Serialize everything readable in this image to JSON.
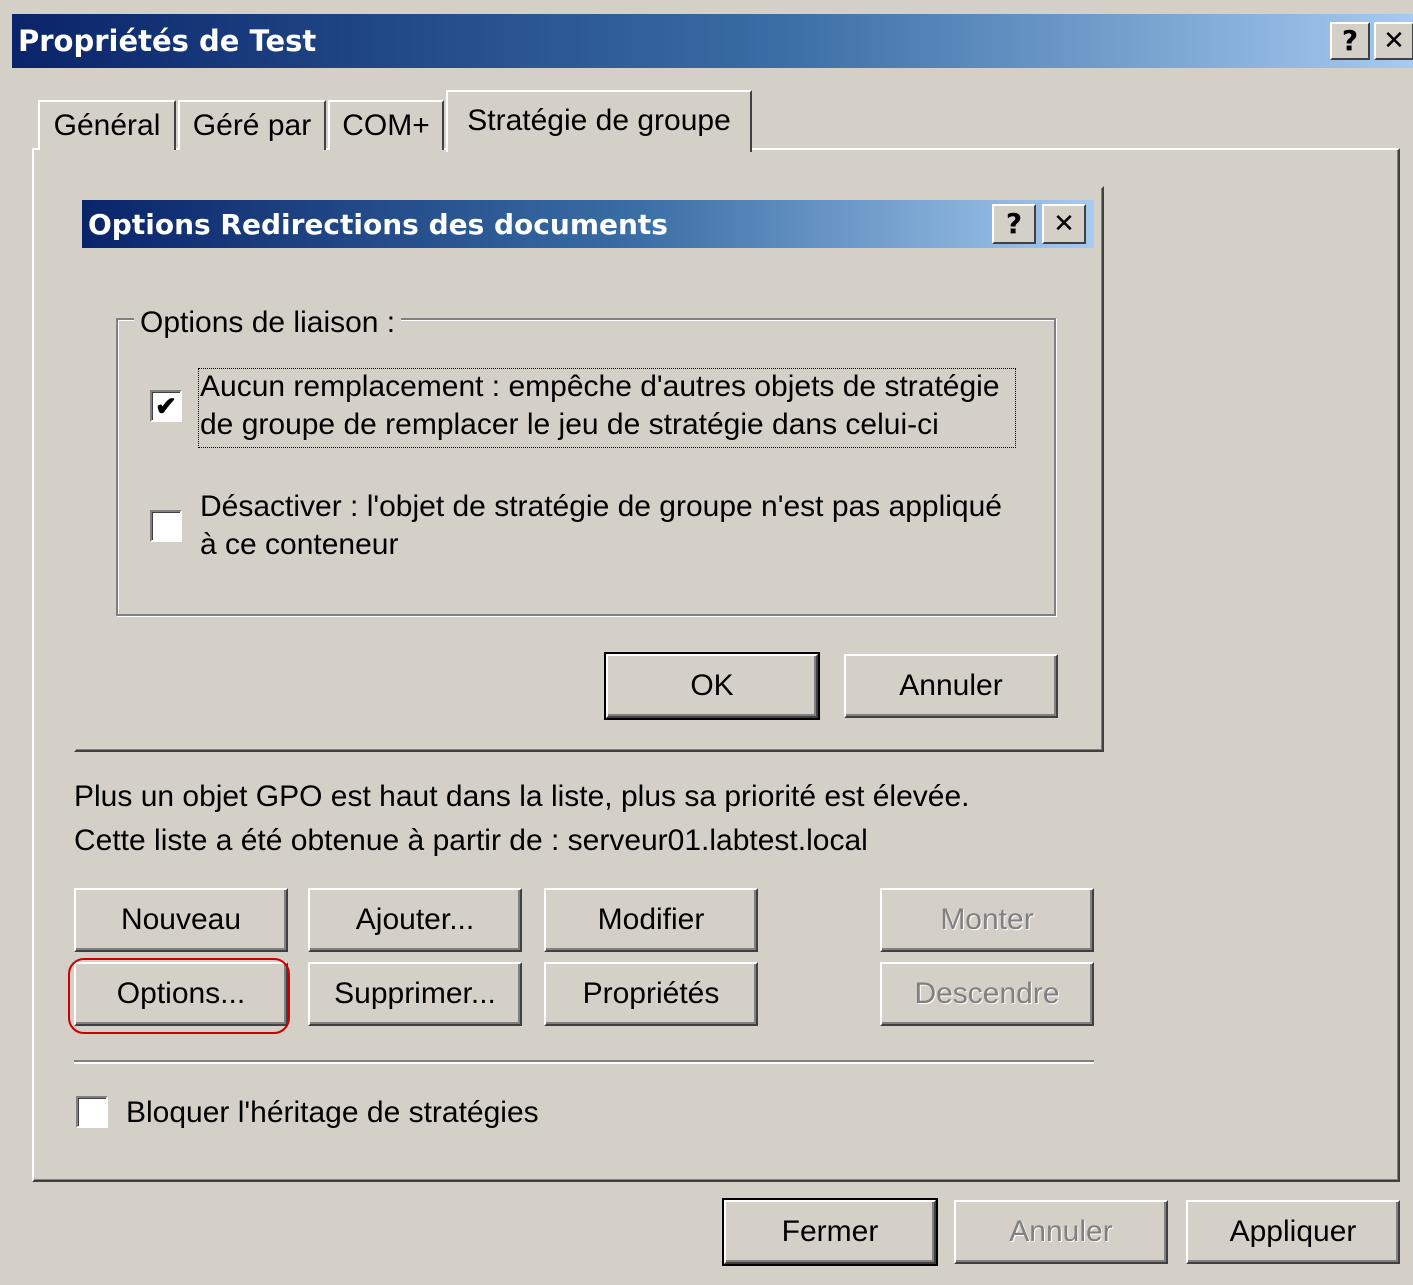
{
  "window": {
    "title": "Propriétés de Test",
    "help_label": "?",
    "close_label": "✕"
  },
  "tabs": [
    {
      "label": "Général"
    },
    {
      "label": "Géré par"
    },
    {
      "label": "COM+"
    },
    {
      "label": "Stratégie de groupe",
      "selected": true
    }
  ],
  "dialog": {
    "title": "Options Redirections des documents",
    "help_label": "?",
    "close_label": "✕",
    "group_label": "Options de liaison :",
    "option1": {
      "line1": "Aucun remplacement : empêche d'autres objets de stratégie",
      "line2": "de groupe de remplacer le jeu de stratégie dans celui-ci",
      "checked": true
    },
    "option2": {
      "line1": "Désactiver : l'objet de stratégie de groupe n'est pas appliqué",
      "line2": "à ce conteneur",
      "checked": false
    },
    "ok_label": "OK",
    "cancel_label": "Annuler"
  },
  "info": {
    "priority_text": "Plus un objet GPO est haut dans la liste, plus sa priorité est élevée.",
    "source_text": "Cette liste a été obtenue à partir de : serveur01.labtest.local"
  },
  "buttons": {
    "nouveau": "Nouveau",
    "ajouter": "Ajouter...",
    "modifier": "Modifier",
    "monter": "Monter",
    "options": "Options...",
    "supprimer": "Supprimer...",
    "proprietes": "Propriétés",
    "descendre": "Descendre"
  },
  "block_inheritance": {
    "label": "Bloquer l'héritage de stratégies",
    "checked": false
  },
  "footer": {
    "close_label": "Fermer",
    "cancel_label": "Annuler",
    "apply_label": "Appliquer"
  },
  "colors": {
    "face": "#d4d0c8",
    "title_start": "#0a246a",
    "title_end": "#a6caf0",
    "highlight_ring": "#cc0000"
  }
}
